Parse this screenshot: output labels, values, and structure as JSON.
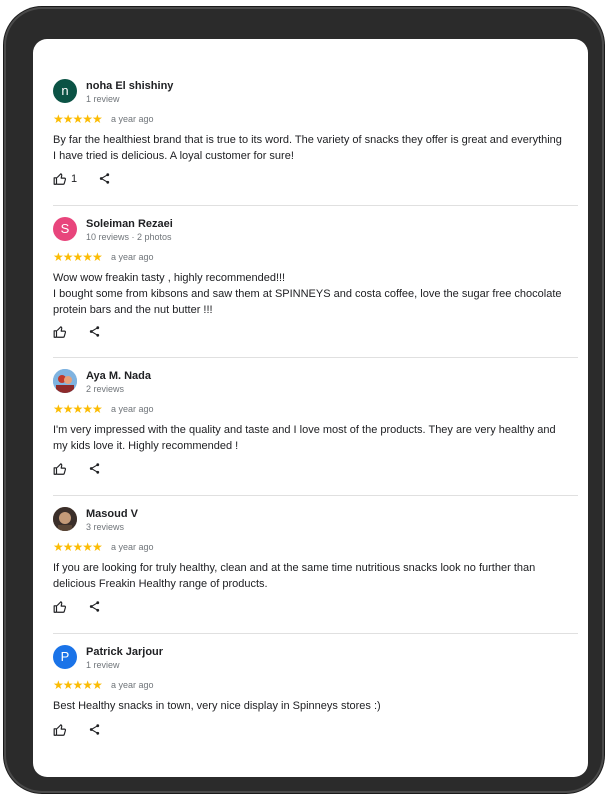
{
  "reviews": [
    {
      "initial": "n",
      "avatar_color": "#0b5345",
      "avatar_type": "letter",
      "name": "noha El shishiny",
      "meta": "1 review",
      "stars": "★★★★★",
      "time": "a year ago",
      "text_lines": [
        "By far the healthiest brand that is true to its word. The variety of snacks they offer is great and everything",
        "I have tried is delicious. A loyal customer for sure!"
      ],
      "likes": "1"
    },
    {
      "initial": "S",
      "avatar_color": "#e8457c",
      "avatar_type": "letter",
      "name": "Soleiman Rezaei",
      "meta": "10 reviews · 2 photos",
      "stars": "★★★★★",
      "time": "a year ago",
      "text_lines": [
        "Wow wow freakin tasty , highly recommended!!!",
        "I bought some from kibsons and saw them at SPINNEYS and costa coffee, love the sugar free chocolate",
        "protein bars and the nut butter !!!"
      ],
      "likes": ""
    },
    {
      "initial": "",
      "avatar_color": "#6fa8dc",
      "avatar_type": "photo",
      "name": "Aya M. Nada",
      "meta": "2 reviews",
      "stars": "★★★★★",
      "time": "a year ago",
      "text_lines": [
        "I'm very impressed with the quality and taste and I love most of the products. They are very healthy and",
        "my kids love it. Highly recommended !"
      ],
      "likes": ""
    },
    {
      "initial": "",
      "avatar_color": "#8a6a52",
      "avatar_type": "photo",
      "name": "Masoud V",
      "meta": "3 reviews",
      "stars": "★★★★★",
      "time": "a year ago",
      "text_lines": [
        "If you are looking for truly healthy, clean and at the same time nutritious snacks look no further than",
        "delicious Freakin Healthy range of products."
      ],
      "likes": ""
    },
    {
      "initial": "P",
      "avatar_color": "#1a73e8",
      "avatar_type": "letter",
      "name": "Patrick Jarjour",
      "meta": "1 review",
      "stars": "★★★★★",
      "time": "a year ago",
      "text_lines": [
        "Best Healthy snacks in town, very nice display in Spinneys stores :)"
      ],
      "likes": ""
    }
  ],
  "icons": {
    "like": "thumbs-up-icon",
    "share": "share-icon"
  },
  "colors": {
    "star": "#fbbc04",
    "divider": "#e0e0e0"
  }
}
